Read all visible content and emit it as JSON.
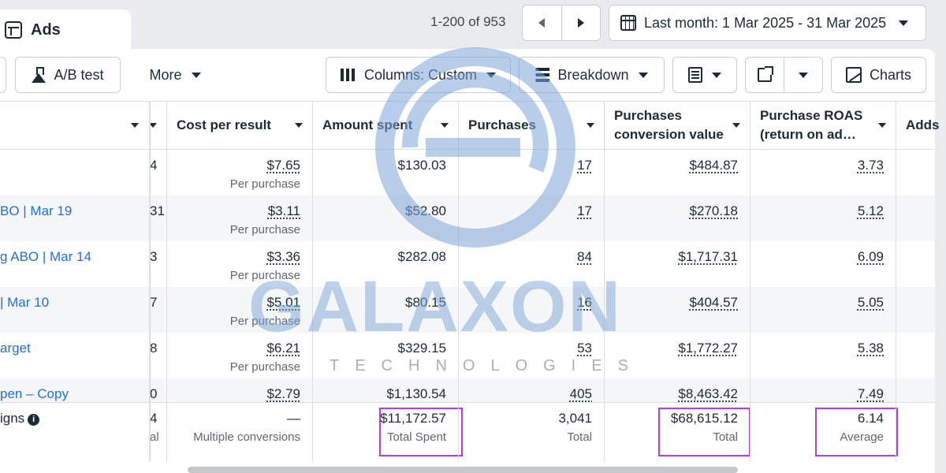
{
  "tab": {
    "label": "Ads"
  },
  "pagination": {
    "range": "1-200 of 953"
  },
  "date_range": {
    "label": "Last month: 1 Mar 2025 - 31 Mar 2025"
  },
  "toolbar": {
    "ab_test": "A/B test",
    "more": "More",
    "columns": "Columns: Custom",
    "breakdown": "Breakdown",
    "charts": "Charts"
  },
  "columns": {
    "cost_per_result": "Cost per result",
    "amount_spent": "Amount spent",
    "purchases": "Purchases",
    "conv_value_l1": "Purchases",
    "conv_value_l2": "conversion value",
    "roas_l1": "Purchase ROAS",
    "roas_l2": "(return on ad…",
    "adds": "Adds"
  },
  "rows": [
    {
      "name": "",
      "frag": "4",
      "cost": "$7.65",
      "cost_sub": "Per purchase",
      "spent": "$130.03",
      "purchases": "17",
      "value": "$484.87",
      "roas": "3.73"
    },
    {
      "name": "BO | Mar 19",
      "frag": "31",
      "cost": "$3.11",
      "cost_sub": "Per purchase",
      "spent": "$52.80",
      "purchases": "17",
      "value": "$270.18",
      "roas": "5.12"
    },
    {
      "name": "g ABO | Mar 14",
      "frag": "3",
      "cost": "$3.36",
      "cost_sub": "Per purchase",
      "spent": "$282.08",
      "purchases": "84",
      "value": "$1,717.31",
      "roas": "6.09"
    },
    {
      "name": "| Mar 10",
      "frag": "7",
      "cost": "$5.01",
      "cost_sub": "Per purchase",
      "spent": "$80.15",
      "purchases": "16",
      "value": "$404.57",
      "roas": "5.05"
    },
    {
      "name": "arget",
      "frag": "8",
      "cost": "$6.21",
      "cost_sub": "Per purchase",
      "spent": "$329.15",
      "purchases": "53",
      "value": "$1,772.27",
      "roas": "5.38"
    },
    {
      "name": "pen – Copy",
      "frag": "0",
      "cost": "$2.79",
      "cost_sub": "",
      "spent": "$1,130.54",
      "purchases": "405",
      "value": "$8,463.42",
      "roas": "7.49"
    }
  ],
  "totals": {
    "name": "igns",
    "frag": "4",
    "frag_sub": "al",
    "cost": "—",
    "cost_sub": "Multiple conversions",
    "spent": "$11,172.57",
    "spent_sub": "Total Spent",
    "purchases": "3,041",
    "purchases_sub": "Total",
    "value": "$68,615.12",
    "value_sub": "Total",
    "roas": "6.14",
    "roas_sub": "Average"
  },
  "watermark": {
    "brand": "GALAXON",
    "tagline": "TECHNOLOGIES"
  },
  "colors": {
    "link": "#216fdb",
    "highlight": "#b33ce6",
    "watermark_blue": "#7ea6d8",
    "watermark_gray": "#8c8c8c"
  }
}
